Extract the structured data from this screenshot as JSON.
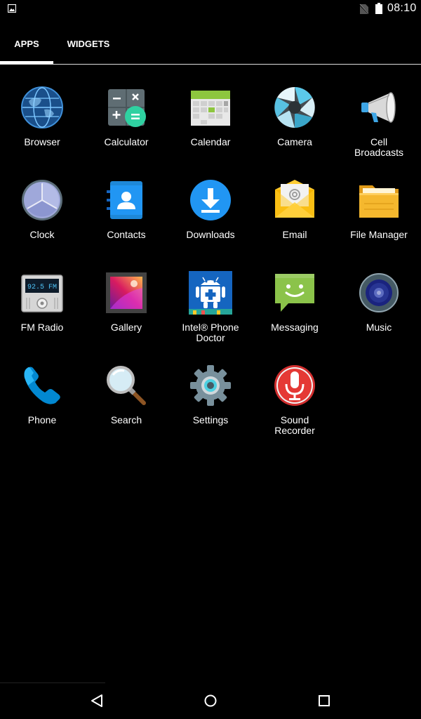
{
  "status_bar": {
    "time": "08:10",
    "icons": [
      "gallery-icon",
      "no-sim-icon",
      "battery-icon"
    ]
  },
  "tabs": [
    {
      "label": "APPS",
      "selected": true
    },
    {
      "label": "WIDGETS",
      "selected": false
    }
  ],
  "apps": [
    {
      "label_lines": [
        "Browser"
      ],
      "icon": "browser-icon"
    },
    {
      "label_lines": [
        "Calculator"
      ],
      "icon": "calculator-icon"
    },
    {
      "label_lines": [
        "Calendar"
      ],
      "icon": "calendar-icon"
    },
    {
      "label_lines": [
        "Camera"
      ],
      "icon": "camera-icon"
    },
    {
      "label_lines": [
        "Cell",
        "Broadcasts"
      ],
      "icon": "cell-broadcasts-icon"
    },
    {
      "label_lines": [
        "Clock"
      ],
      "icon": "clock-icon"
    },
    {
      "label_lines": [
        "Contacts"
      ],
      "icon": "contacts-icon"
    },
    {
      "label_lines": [
        "Downloads"
      ],
      "icon": "downloads-icon"
    },
    {
      "label_lines": [
        "Email"
      ],
      "icon": "email-icon"
    },
    {
      "label_lines": [
        "File Manager"
      ],
      "icon": "file-manager-icon"
    },
    {
      "label_lines": [
        "FM Radio"
      ],
      "icon": "fm-radio-icon",
      "icon_text": "92.5 FM"
    },
    {
      "label_lines": [
        "Gallery"
      ],
      "icon": "gallery-app-icon"
    },
    {
      "label_lines": [
        "Intel® Phone",
        "Doctor"
      ],
      "icon": "phone-doctor-icon"
    },
    {
      "label_lines": [
        "Messaging"
      ],
      "icon": "messaging-icon"
    },
    {
      "label_lines": [
        "Music"
      ],
      "icon": "music-icon"
    },
    {
      "label_lines": [
        "Phone"
      ],
      "icon": "phone-icon"
    },
    {
      "label_lines": [
        "Search"
      ],
      "icon": "search-icon"
    },
    {
      "label_lines": [
        "Settings"
      ],
      "icon": "settings-icon"
    },
    {
      "label_lines": [
        "Sound",
        "Recorder"
      ],
      "icon": "sound-recorder-icon"
    }
  ],
  "nav_bar": {
    "buttons": [
      "back-icon",
      "home-icon",
      "recents-icon"
    ]
  },
  "colors": {
    "background": "#000000",
    "text": "#ffffff",
    "tab_indicator": "#ffffff"
  }
}
